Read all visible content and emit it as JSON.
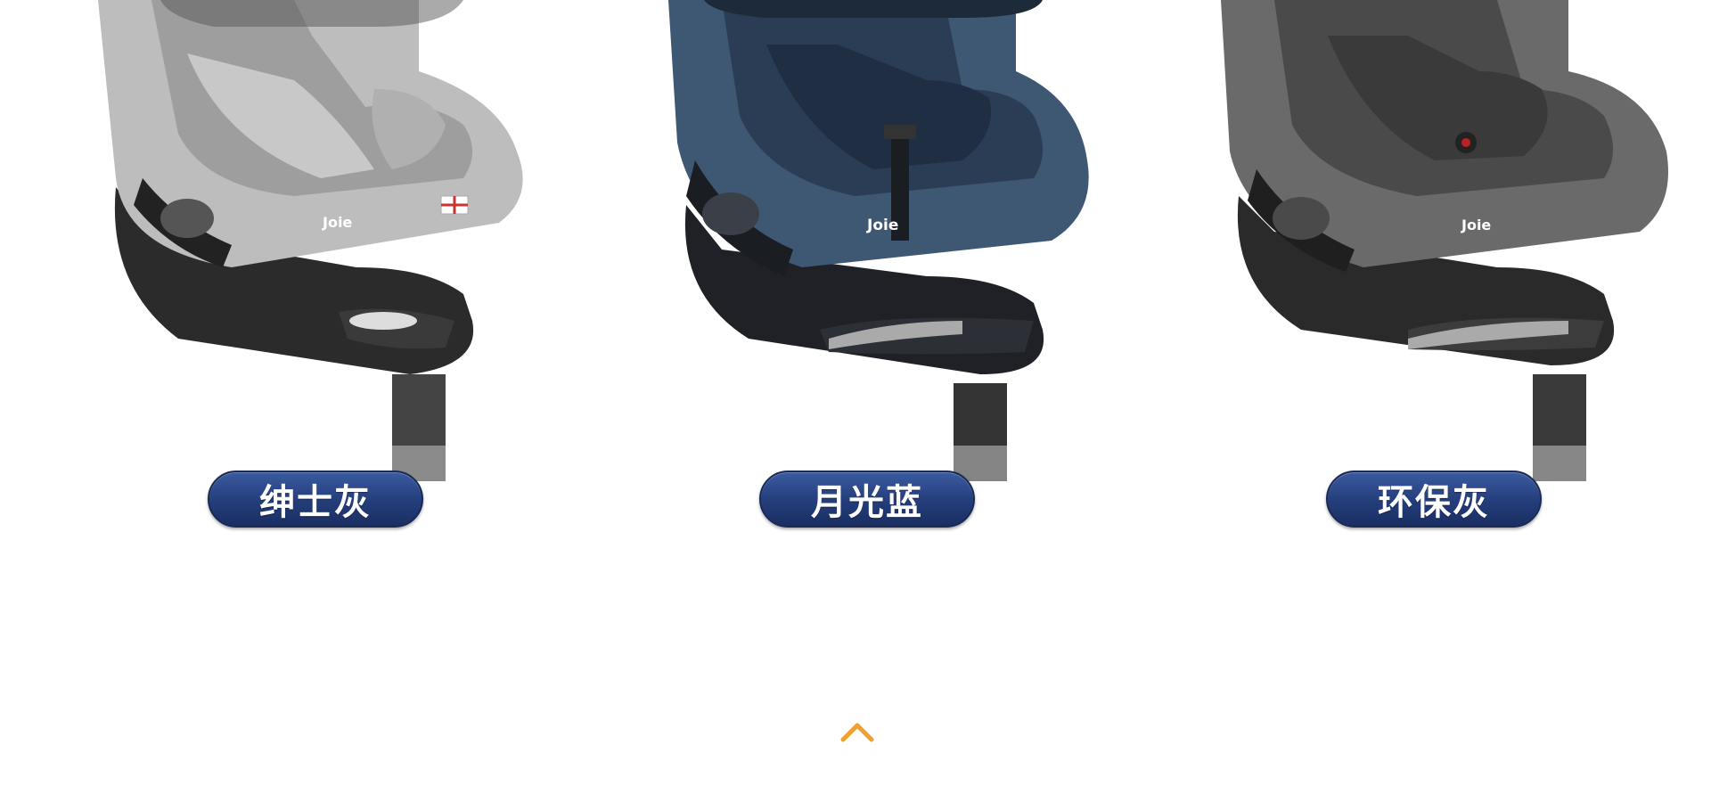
{
  "products": [
    {
      "color_label": "绅士灰",
      "brand_mark": "Joie",
      "shell_color": "#bdbdbd",
      "seat_color": "#9e9e9e",
      "base_color": "#2b2b2b"
    },
    {
      "color_label": "月光蓝",
      "brand_mark": "Joie",
      "shell_color": "#3e5873",
      "seat_color": "#2a3d55",
      "base_color": "#1f2126"
    },
    {
      "color_label": "环保灰",
      "brand_mark": "Joie",
      "shell_color": "#6a6a6a",
      "seat_color": "#4a4a4a",
      "base_color": "#2a2a2a"
    }
  ],
  "scroll_top": {
    "icon": "chevron-up-icon",
    "color": "#f0a030"
  },
  "theme": {
    "pill_color": "#243d7a",
    "background": "#ffffff"
  }
}
